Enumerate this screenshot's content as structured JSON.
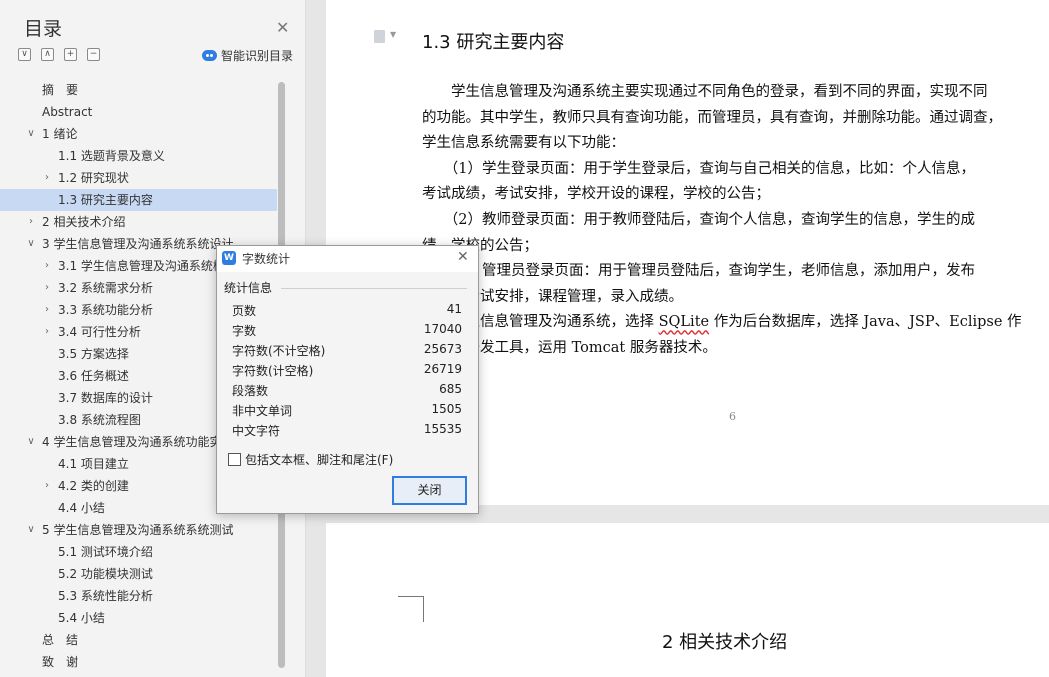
{
  "toc": {
    "title": "目录",
    "smart_label": "智能识别目录",
    "tool_buttons": [
      "∨",
      "∧",
      "+",
      "−"
    ],
    "items": [
      {
        "label": "摘　要",
        "level": 0,
        "chevron": "",
        "selected": false
      },
      {
        "label": "Abstract",
        "level": 0,
        "chevron": "",
        "selected": false
      },
      {
        "label": "1  绪论",
        "level": 0,
        "chevron": "∨",
        "selected": false
      },
      {
        "label": "1.1  选题背景及意义",
        "level": 1,
        "chevron": "",
        "selected": false
      },
      {
        "label": "1.2  研究现状",
        "level": 1,
        "chevron": "›",
        "selected": false
      },
      {
        "label": "1.3  研究主要内容",
        "level": 1,
        "chevron": "",
        "selected": true
      },
      {
        "label": "2  相关技术介绍",
        "level": 0,
        "chevron": "›",
        "selected": false
      },
      {
        "label": "3  学生信息管理及沟通系统系统设计",
        "level": 0,
        "chevron": "∨",
        "selected": false
      },
      {
        "label": "3.1  学生信息管理及沟通系统概",
        "level": 1,
        "chevron": "›",
        "selected": false
      },
      {
        "label": "3.2  系统需求分析",
        "level": 1,
        "chevron": "›",
        "selected": false
      },
      {
        "label": "3.3  系统功能分析",
        "level": 1,
        "chevron": "›",
        "selected": false
      },
      {
        "label": "3.4  可行性分析",
        "level": 1,
        "chevron": "›",
        "selected": false
      },
      {
        "label": "3.5  方案选择",
        "level": 1,
        "chevron": "",
        "selected": false
      },
      {
        "label": "3.6  任务概述",
        "level": 1,
        "chevron": "",
        "selected": false
      },
      {
        "label": "3.7  数据库的设计",
        "level": 1,
        "chevron": "",
        "selected": false
      },
      {
        "label": "3.8  系统流程图",
        "level": 1,
        "chevron": "",
        "selected": false
      },
      {
        "label": "4  学生信息管理及沟通系统功能实",
        "level": 0,
        "chevron": "∨",
        "selected": false
      },
      {
        "label": "4.1  项目建立",
        "level": 1,
        "chevron": "",
        "selected": false
      },
      {
        "label": "4.2  类的创建",
        "level": 1,
        "chevron": "›",
        "selected": false
      },
      {
        "label": "4.4  小结",
        "level": 1,
        "chevron": "",
        "selected": false
      },
      {
        "label": "5  学生信息管理及沟通系统系统测试",
        "level": 0,
        "chevron": "∨",
        "selected": false
      },
      {
        "label": "5.1  测试环境介绍",
        "level": 1,
        "chevron": "",
        "selected": false
      },
      {
        "label": "5.2  功能模块测试",
        "level": 1,
        "chevron": "",
        "selected": false
      },
      {
        "label": "5.3  系统性能分析",
        "level": 1,
        "chevron": "",
        "selected": false
      },
      {
        "label": "5.4  小结",
        "level": 1,
        "chevron": "",
        "selected": false
      },
      {
        "label": "总　结",
        "level": 0,
        "chevron": "",
        "selected": false
      },
      {
        "label": "致　谢",
        "level": 0,
        "chevron": "",
        "selected": false
      }
    ]
  },
  "document": {
    "heading": "1.3  研究主要内容",
    "lines": [
      "　　学生信息管理及沟通系统主要实现通过不同角色的登录，看到不同的界面，实现不同",
      "的功能。其中学生，教师只具有查询功能，而管理员，具有查询，并删除功能。通过调查，",
      "学生信息系统需要有以下功能：",
      "　　（1）学生登录页面：用于学生登录后，查询与自己相关的信息，比如：个人信息，",
      "考试成绩，考试安排，学校开设的课程，学校的公告；",
      "　　（2）教师登录页面：用于教师登陆后，查询个人信息，查询学生的信息，学生的成",
      "绩，学校的公告；",
      "　　（3）管理员登录页面：用于管理员登陆后，查询学生，老师信息，添加用户，发布",
      "公告，考试安排，课程管理，录入成绩。",
      "　　学生信息管理及沟通系统，选择 SQLite 作为后台数据库，选择 Java、JSP、Eclipse 作",
      "为程序开发工具，运用 Tomcat 服务器技术。"
    ],
    "page_number": "6",
    "next_heading": "2  相关技术介绍"
  },
  "dialog": {
    "title": "字数统计",
    "group_label": "统计信息",
    "stats": [
      {
        "label": "页数",
        "value": "41"
      },
      {
        "label": "字数",
        "value": "17040"
      },
      {
        "label": "字符数(不计空格)",
        "value": "25673"
      },
      {
        "label": "字符数(计空格)",
        "value": "26719"
      },
      {
        "label": "段落数",
        "value": "685"
      },
      {
        "label": "非中文单词",
        "value": "1505"
      },
      {
        "label": "中文字符",
        "value": "15535"
      }
    ],
    "checkbox_label": "包括文本框、脚注和尾注(F)",
    "close_button": "关闭"
  },
  "colors": {
    "accent": "#2f7de1",
    "toc_selected": "#c8d9f3"
  }
}
